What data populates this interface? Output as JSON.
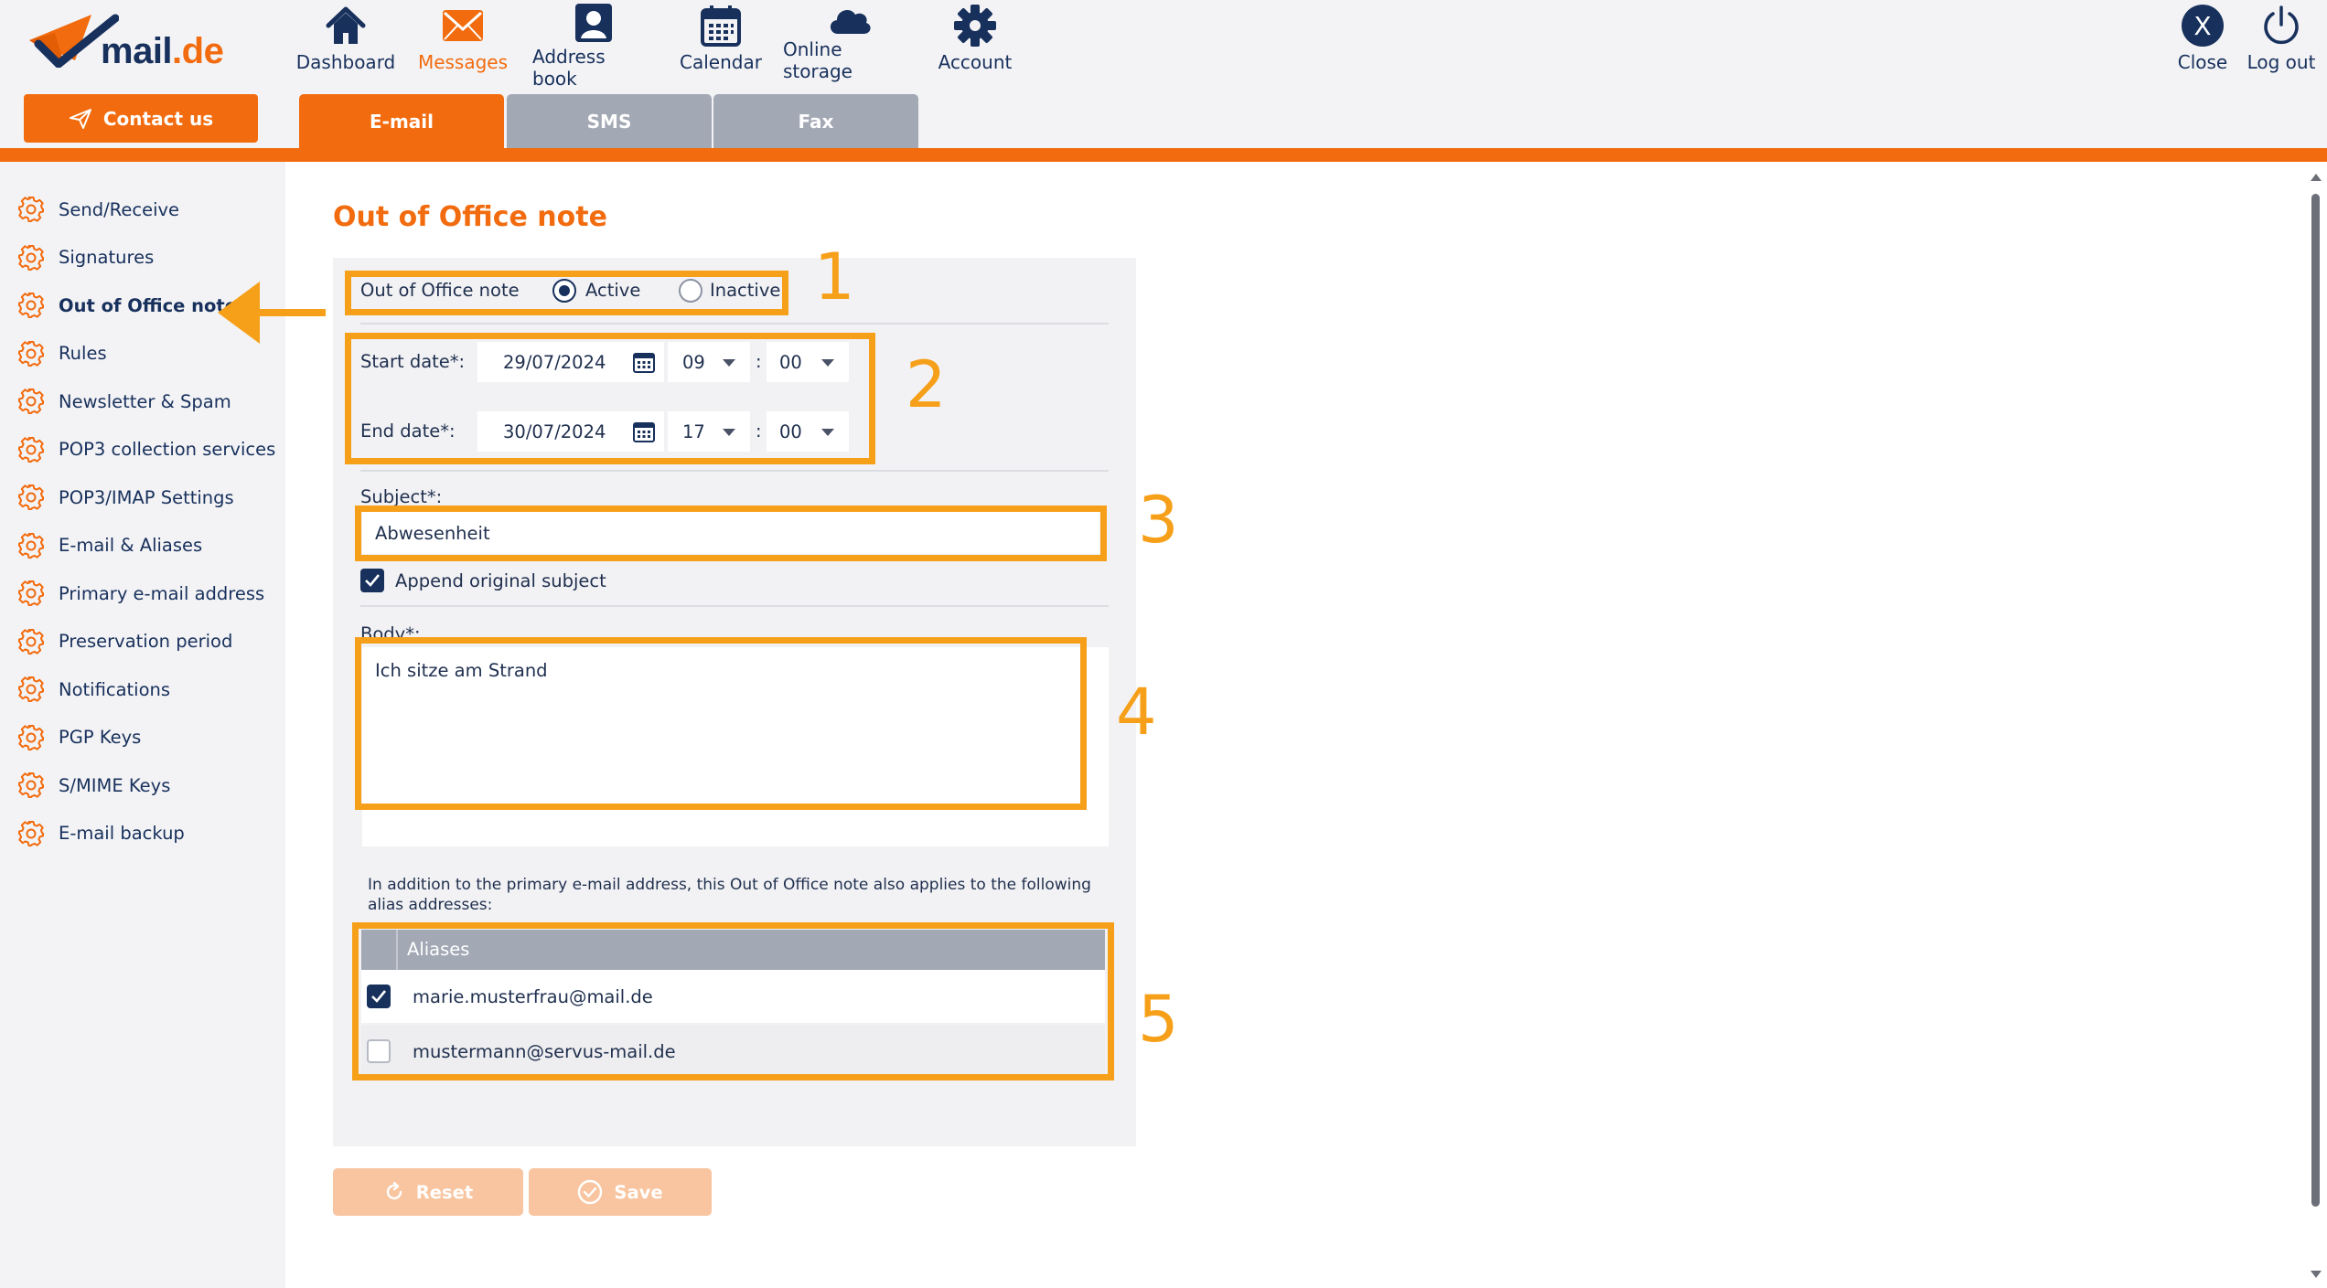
{
  "brand": {
    "name": "mail",
    "tld": ".de"
  },
  "contact_button": {
    "label": "Contact us"
  },
  "nav": [
    {
      "label": "Dashboard",
      "icon": "home-icon",
      "active": false
    },
    {
      "label": "Messages",
      "icon": "envelope-icon",
      "active": true
    },
    {
      "label": "Address book",
      "icon": "contact-card-icon",
      "active": false
    },
    {
      "label": "Calendar",
      "icon": "calendar-icon",
      "active": false
    },
    {
      "label": "Online storage",
      "icon": "cloud-icon",
      "active": false
    },
    {
      "label": "Account",
      "icon": "gear-icon",
      "active": false
    }
  ],
  "top_right": {
    "close_label": "Close",
    "close_glyph": "X",
    "logout_label": "Log out"
  },
  "tabs": [
    {
      "label": "E-mail",
      "active": true
    },
    {
      "label": "SMS",
      "active": false
    },
    {
      "label": "Fax",
      "active": false
    }
  ],
  "sidebar": {
    "items": [
      {
        "label": "Send/Receive"
      },
      {
        "label": "Signatures"
      },
      {
        "label": "Out of Office note",
        "active": true
      },
      {
        "label": "Rules"
      },
      {
        "label": "Newsletter & Spam"
      },
      {
        "label": "POP3 collection services"
      },
      {
        "label": "POP3/IMAP Settings"
      },
      {
        "label": "E-mail & Aliases"
      },
      {
        "label": "Primary e-mail address"
      },
      {
        "label": "Preservation period"
      },
      {
        "label": "Notifications"
      },
      {
        "label": "PGP Keys"
      },
      {
        "label": "S/MIME Keys"
      },
      {
        "label": "E-mail backup"
      }
    ]
  },
  "form": {
    "title": "Out of Office note",
    "status": {
      "label": "Out of Office note",
      "active_label": "Active",
      "inactive_label": "Inactive",
      "selected": "Active"
    },
    "start": {
      "label": "Start date*:",
      "date": "29/07/2024",
      "hour": "09",
      "minute": "00"
    },
    "end": {
      "label": "End date*:",
      "date": "30/07/2024",
      "hour": "17",
      "minute": "00"
    },
    "subject": {
      "label": "Subject*:",
      "value": "Abwesenheit"
    },
    "append_subject": {
      "label": "Append original subject",
      "checked": true
    },
    "body": {
      "label": "Body*:",
      "value": "Ich sitze am Strand"
    },
    "aliases_note": "In addition to the primary e-mail address, this Out of Office note also applies to the following alias addresses:",
    "aliases_header": "Aliases",
    "aliases": [
      {
        "address": "marie.musterfrau@mail.de",
        "checked": true
      },
      {
        "address": "mustermann@servus-mail.de",
        "checked": false
      }
    ],
    "reset_label": "Reset",
    "save_label": "Save"
  },
  "annotations": {
    "n1": "1",
    "n2": "2",
    "n3": "3",
    "n4": "4",
    "n5": "5"
  },
  "colors": {
    "accent": "#f26b0e",
    "navy": "#17305c",
    "annotation": "#f6a01a",
    "tab_inactive": "#a2a8b4"
  }
}
